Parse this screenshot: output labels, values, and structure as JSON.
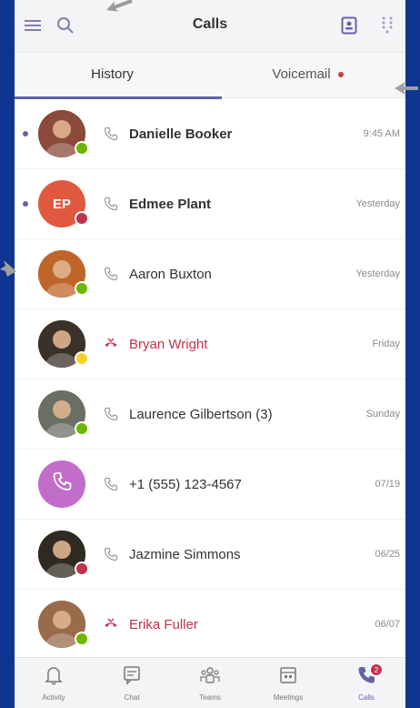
{
  "colors": {
    "brand": "#6264a7",
    "background": "#0f3591",
    "missed": "#c4314b",
    "available": "#6bb700",
    "busy": "#c4314b",
    "away": "#f8d22a"
  },
  "header": {
    "title": "Calls",
    "left_icons": [
      "hamburger-menu-icon",
      "search-icon"
    ],
    "right_icons": [
      "contact-card-icon",
      "dialpad-icon"
    ]
  },
  "tabs": [
    {
      "label": "History",
      "active": true
    },
    {
      "label": "Voicemail",
      "active": false,
      "has_unread_dot": true
    }
  ],
  "calls": [
    {
      "name": "Danielle Booker",
      "time": "9:45 AM",
      "unread": true,
      "bold": true,
      "missed": false,
      "presence": "available",
      "avatar_type": "photo",
      "avatar_color": "#8b4a3a"
    },
    {
      "name": "Edmee Plant",
      "time": "Yesterday",
      "unread": true,
      "bold": true,
      "missed": false,
      "presence": "busy",
      "avatar_type": "initials",
      "initials": "EP",
      "avatar_color": "#e0593e"
    },
    {
      "name": "Aaron Buxton",
      "time": "Yesterday",
      "unread": false,
      "bold": false,
      "missed": false,
      "presence": "available",
      "avatar_type": "photo",
      "avatar_color": "#c0652a"
    },
    {
      "name": "Bryan Wright",
      "time": "Friday",
      "unread": false,
      "bold": false,
      "missed": true,
      "presence": "away",
      "avatar_type": "photo",
      "avatar_color": "#3b3128"
    },
    {
      "name": "Laurence Gilbertson (3)",
      "time": "Sunday",
      "unread": false,
      "bold": false,
      "missed": false,
      "presence": "available",
      "avatar_type": "photo",
      "avatar_color": "#6a6f64"
    },
    {
      "name": "+1 (555) 123-4567",
      "time": "07/19",
      "unread": false,
      "bold": false,
      "missed": false,
      "presence": "none",
      "avatar_type": "phone",
      "avatar_color": "#c06ec9"
    },
    {
      "name": "Jazmine Simmons",
      "time": "06/25",
      "unread": false,
      "bold": false,
      "missed": false,
      "presence": "busy",
      "avatar_type": "photo",
      "avatar_color": "#2f2a22"
    },
    {
      "name": "Erika Fuller",
      "time": "06/07",
      "unread": false,
      "bold": false,
      "missed": true,
      "presence": "available",
      "avatar_type": "photo",
      "avatar_color": "#9a6b4b"
    }
  ],
  "bottom_nav": [
    {
      "label": "Activity",
      "icon": "bell-icon"
    },
    {
      "label": "Chat",
      "icon": "chat-icon"
    },
    {
      "label": "Teams",
      "icon": "teams-icon"
    },
    {
      "label": "Meetings",
      "icon": "calendar-icon"
    },
    {
      "label": "Calls",
      "icon": "phone-icon",
      "active": true,
      "badge": "2"
    }
  ]
}
